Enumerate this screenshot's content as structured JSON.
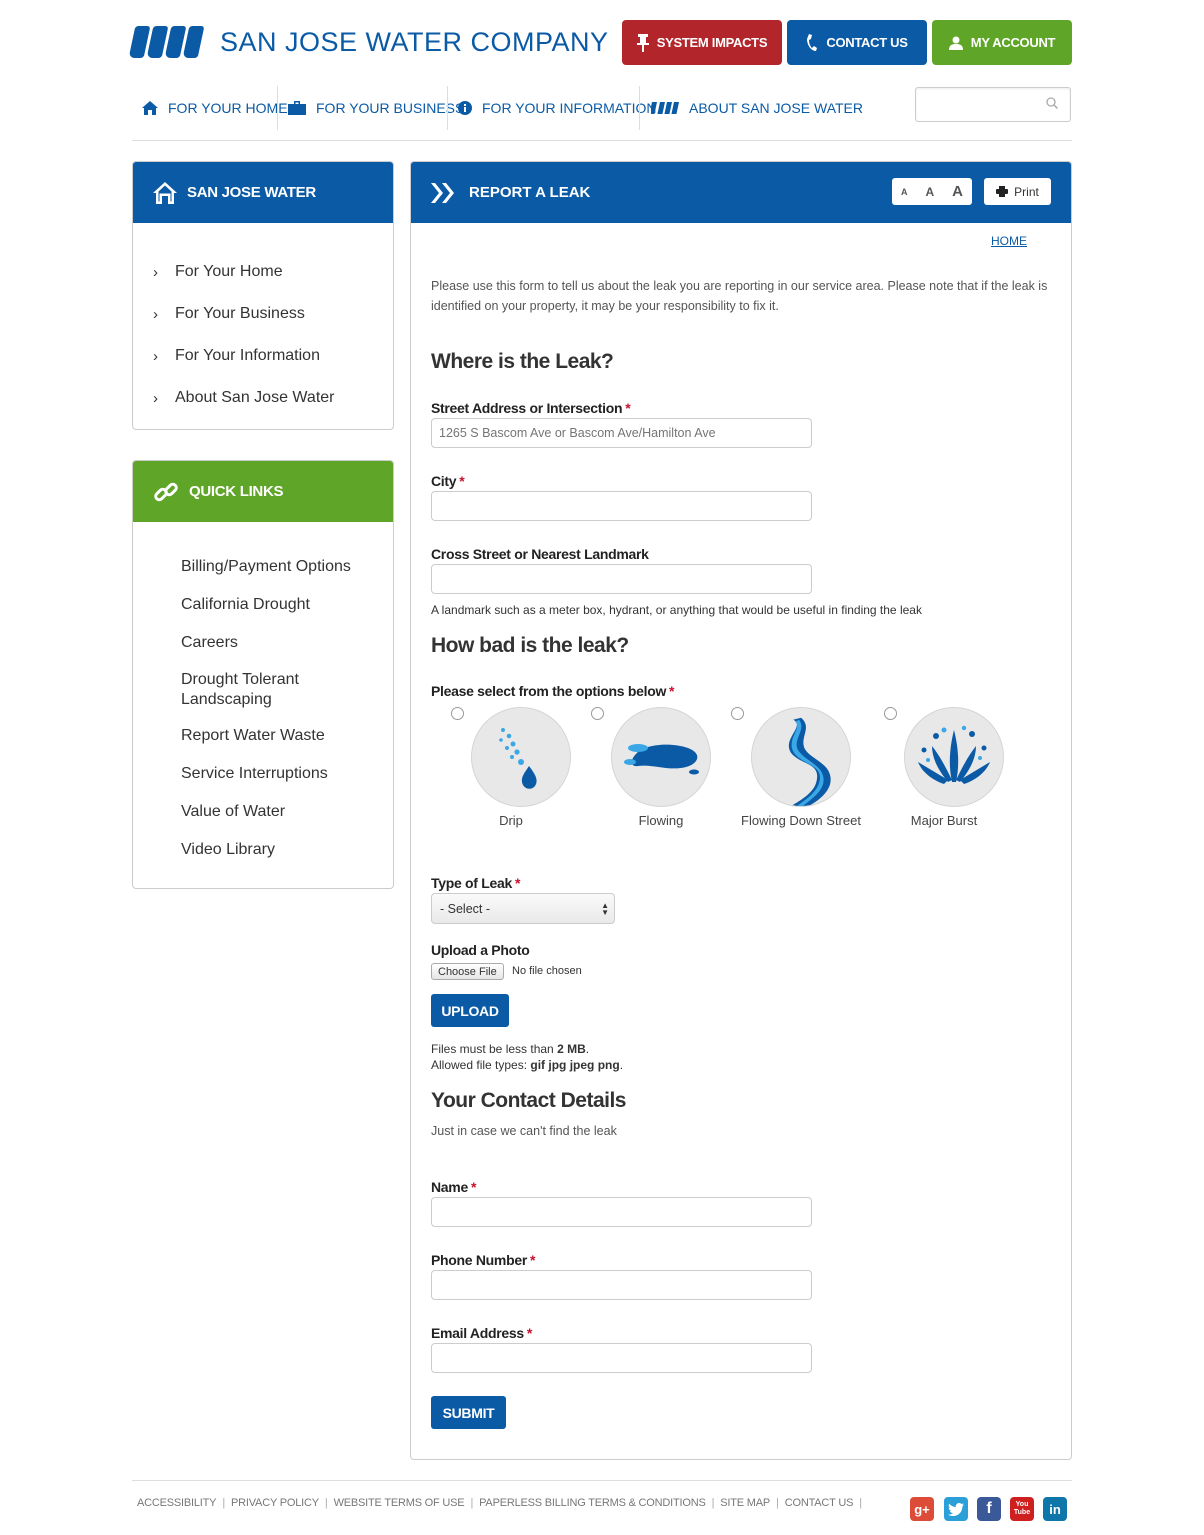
{
  "brand": {
    "name": "SAN JOSE WATER COMPANY",
    "primary": "#0b5aa6",
    "alert": "#b2252b",
    "green": "#5fa528"
  },
  "top_buttons": {
    "impacts": "SYSTEM IMPACTS",
    "contact": "CONTACT US",
    "account": "MY ACCOUNT"
  },
  "nav": {
    "home": "FOR YOUR HOME",
    "business": "FOR YOUR BUSINESS",
    "information": "FOR YOUR INFORMATION",
    "about": "ABOUT SAN JOSE WATER",
    "search_value": ""
  },
  "sidebar": {
    "title": "SAN JOSE WATER",
    "items": [
      "For Your Home",
      "For Your Business",
      "For Your Information",
      "About San Jose Water"
    ]
  },
  "quick_links": {
    "title": "QUICK LINKS",
    "items": [
      "Billing/Payment Options",
      "California Drought",
      "Careers",
      "Drought Tolerant Landscaping",
      "Report Water Waste",
      "Service Interruptions",
      "Value of Water",
      "Video Library"
    ]
  },
  "main": {
    "title": "REPORT A LEAK",
    "font_sizes": [
      "A",
      "A",
      "A"
    ],
    "print": "Print",
    "breadcrumb": "HOME",
    "intro": "Please use this form to tell us about the leak you are reporting in our service area.  Please note that if the leak is identified on your property, it may be your responsibility to fix it.",
    "where_heading": "Where is the Leak?",
    "street_label": "Street Address or Intersection",
    "street_placeholder": "1265 S Bascom Ave or Bascom Ave/Hamilton Ave",
    "city_label": "City",
    "cross_label": "Cross Street or Nearest Landmark",
    "cross_hint": "A landmark such as a meter box, hydrant, or anything that would be useful in finding the leak",
    "how_heading": "How bad is the leak?",
    "select_label": "Please select from the options below",
    "severity_options": [
      "Drip",
      "Flowing",
      "Flowing Down Street",
      "Major Burst"
    ],
    "type_label": "Type of Leak",
    "type_selected": "- Select -",
    "photo_label": "Upload a Photo",
    "choose_file": "Choose File",
    "no_file": "No file chosen",
    "upload": "UPLOAD",
    "files_note_prefix": "Files must be less than ",
    "files_note_size": "2 MB",
    "files_note_suffix": ".",
    "types_note_prefix": "Allowed file types: ",
    "types_note_types": "gif jpg jpeg png",
    "types_note_suffix": ".",
    "contact_heading": "Your Contact Details",
    "contact_sub": "Just in case we can't find the leak",
    "name_label": "Name",
    "phone_label": "Phone Number",
    "email_label": "Email Address",
    "submit": "SUBMIT",
    "required_mark": "*"
  },
  "footer": {
    "links": [
      "ACCESSIBILITY",
      "PRIVACY POLICY",
      "WEBSITE TERMS OF USE",
      "PAPERLESS BILLING TERMS & CONDITIONS",
      "SITE MAP",
      "CONTACT US"
    ],
    "separator": "|",
    "social": {
      "google": "g+",
      "facebook": "f",
      "youtube": "You Tube",
      "linkedin": "in"
    }
  }
}
